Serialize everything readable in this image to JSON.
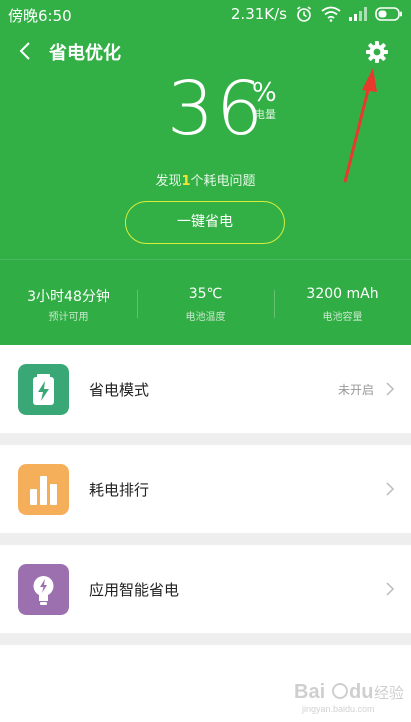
{
  "status_bar": {
    "time": "傍晚6:50",
    "speed": "2.31K/s"
  },
  "header": {
    "title": "省电优化"
  },
  "battery": {
    "percent": "36",
    "percent_sign": "%",
    "unit_label": "电量",
    "issue_prefix": "发现",
    "issue_count": "1",
    "issue_suffix": "个耗电问题",
    "optimize_button": "一键省电"
  },
  "stats": [
    {
      "value": "3小时48分钟",
      "label": "预计可用"
    },
    {
      "value": "35℃",
      "label": "电池温度"
    },
    {
      "value": "3200 mAh",
      "label": "电池容量"
    }
  ],
  "list": [
    {
      "label": "省电模式",
      "status": "未开启",
      "icon": "battery-charge-icon"
    },
    {
      "label": "耗电排行",
      "status": "",
      "icon": "bar-chart-icon"
    },
    {
      "label": "应用智能省电",
      "status": "",
      "icon": "lightbulb-icon"
    }
  ],
  "colors": {
    "header_green": "#32b045",
    "button_border": "#d8ee3c",
    "issue_highlight": "#f4e634",
    "icon_mode": "#3aa876",
    "icon_rank": "#f5ae5a",
    "icon_smart": "#9c6fae",
    "annotation_arrow": "#e8392d"
  },
  "watermark": {
    "text": "Bai du 经验",
    "sub": "jingyan.baidu.com"
  }
}
